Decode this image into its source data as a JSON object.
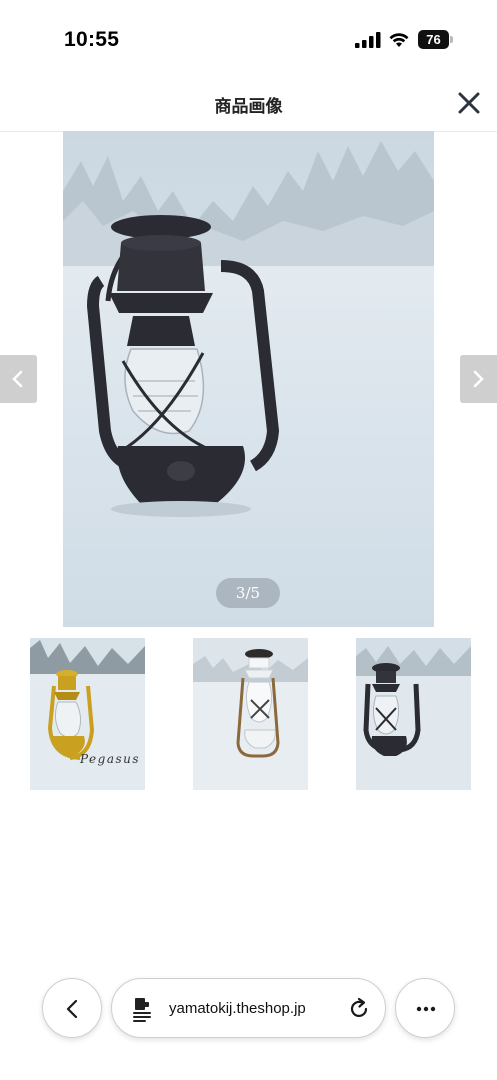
{
  "status_bar": {
    "time": "10:55",
    "battery": "76"
  },
  "header": {
    "title": "商品画像"
  },
  "gallery": {
    "counter": "3/5",
    "main_image": {
      "subject": "black lantern in snow",
      "glass_color": "#e9eef2",
      "body_color": "#2a2b33"
    },
    "thumbnails": [
      {
        "subject": "gold lantern in snow",
        "caption": "Pegasus"
      },
      {
        "subject": "white lantern in snow"
      },
      {
        "subject": "black lantern in snow"
      }
    ]
  },
  "browser": {
    "url": "yamatokij.theshop.jp"
  },
  "icons": {
    "close": "close-icon",
    "prev": "chevron-left-icon",
    "next": "chevron-right-icon",
    "back": "back-icon",
    "page": "page-icon",
    "reload": "reload-icon",
    "more": "more-icon"
  },
  "colors": {
    "snow": "#d9e4ec",
    "sky": "#cfdae3",
    "arrow_bg": "#cfcfcf",
    "counter_bg": "#8c96a0"
  }
}
